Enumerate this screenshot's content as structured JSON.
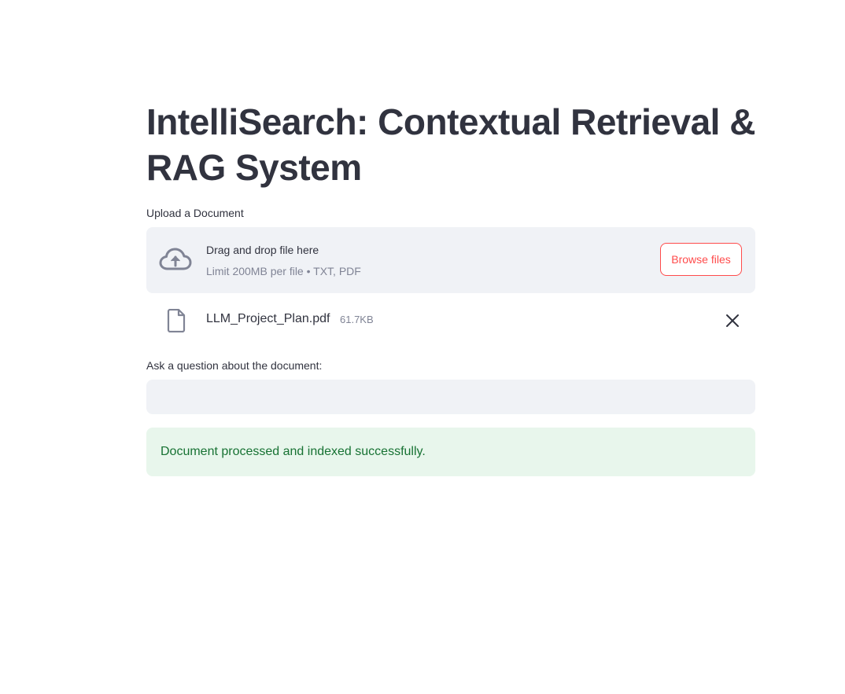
{
  "page": {
    "title": "IntelliSearch: Contextual Retrieval & RAG System"
  },
  "uploader": {
    "label": "Upload a Document",
    "drag_text": "Drag and drop file here",
    "limit_text": "Limit 200MB per file • TXT, PDF",
    "browse_label": "Browse files",
    "icon": "cloud-upload-icon"
  },
  "uploaded_file": {
    "name": "LLM_Project_Plan.pdf",
    "size": "61.7KB",
    "icon": "file-icon",
    "remove_icon": "close-icon"
  },
  "question": {
    "label": "Ask a question about the document:",
    "value": "",
    "placeholder": ""
  },
  "status": {
    "message": "Document processed and indexed successfully.",
    "colors": {
      "background": "#e8f6ec",
      "text": "#177233"
    }
  },
  "colors": {
    "accent": "#ff4b4b",
    "text": "#31333f",
    "muted": "#808495",
    "input_bg": "#f0f2f6"
  }
}
